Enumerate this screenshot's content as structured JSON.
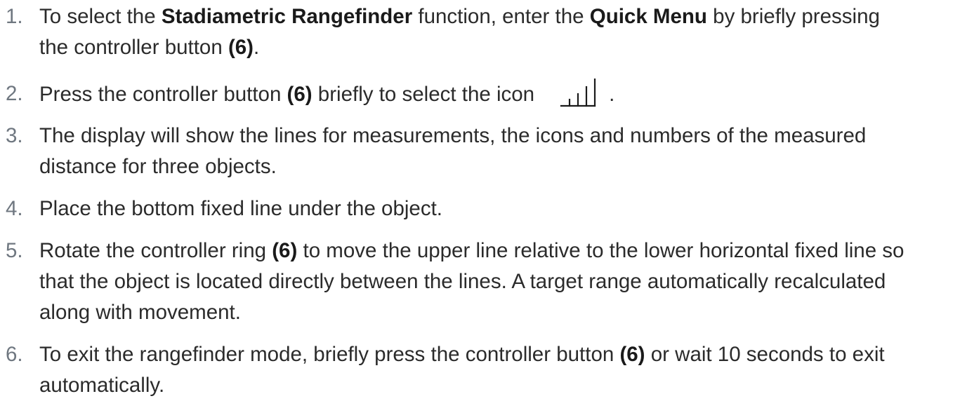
{
  "steps": [
    {
      "number": "1.",
      "parts": [
        {
          "text": "To select the ",
          "bold": false
        },
        {
          "text": "Stadiametric Rangefinder",
          "bold": true
        },
        {
          "text": " function, enter the ",
          "bold": false
        },
        {
          "text": "Quick Menu",
          "bold": true
        },
        {
          "text": " by briefly pressing the controller button ",
          "bold": false
        },
        {
          "text": "(6)",
          "bold": true
        },
        {
          "text": ".",
          "bold": false
        }
      ]
    },
    {
      "number": "2.",
      "parts": [
        {
          "text": "Press the controller button ",
          "bold": false
        },
        {
          "text": "(6)",
          "bold": true
        },
        {
          "text": " briefly to select the icon",
          "bold": false
        },
        {
          "icon": "stadiametric-rangefinder-icon"
        },
        {
          "text": ".",
          "bold": false
        }
      ]
    },
    {
      "number": "3.",
      "parts": [
        {
          "text": "The display will show the lines for measurements, the icons and numbers of the measured distance for three objects.",
          "bold": false
        }
      ]
    },
    {
      "number": "4.",
      "parts": [
        {
          "text": "Place the bottom fixed line under the object.",
          "bold": false
        }
      ]
    },
    {
      "number": "5.",
      "parts": [
        {
          "text": "Rotate the controller ring ",
          "bold": false
        },
        {
          "text": "(6)",
          "bold": true
        },
        {
          "text": " to move the upper line relative to the lower horizontal fixed line so that the object is located directly between the lines. A target range automatically recalculated along with movement.",
          "bold": false
        }
      ]
    },
    {
      "number": "6.",
      "parts": [
        {
          "text": "To exit the rangefinder mode, briefly press the controller button ",
          "bold": false
        },
        {
          "text": "(6)",
          "bold": true
        },
        {
          "text": " or wait 10 seconds to exit automatically.",
          "bold": false
        }
      ]
    }
  ]
}
